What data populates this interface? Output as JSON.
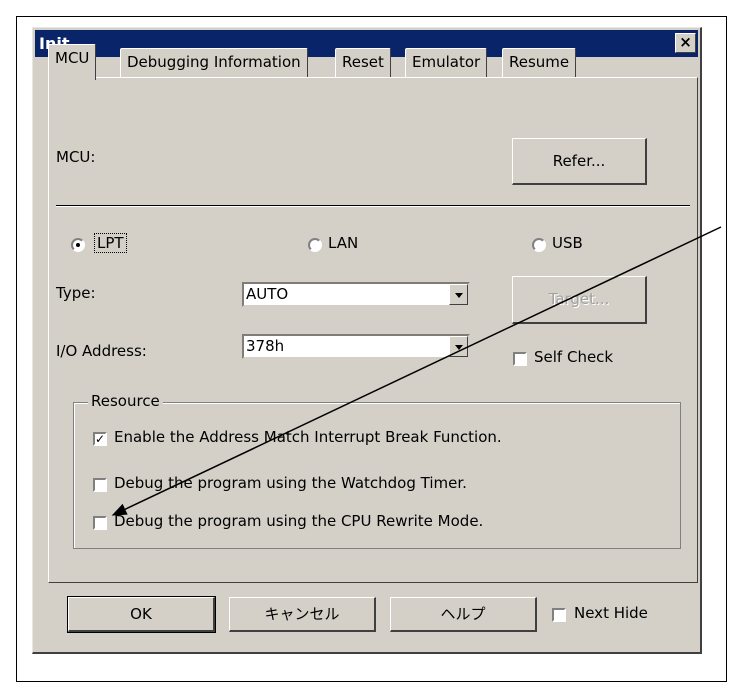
{
  "window": {
    "title": "Init",
    "close_label": "×"
  },
  "tabs": [
    {
      "label": "MCU",
      "active": true
    },
    {
      "label": "Debugging Information"
    },
    {
      "label": "Reset"
    },
    {
      "label": "Emulator"
    },
    {
      "label": "Resume"
    }
  ],
  "mcu": {
    "label": "MCU:",
    "refer_button": "Refer..."
  },
  "connection": {
    "lpt": "LPT",
    "lan": "LAN",
    "usb": "USB",
    "selected": "LPT"
  },
  "fields": {
    "type_label": "Type:",
    "type_value": "AUTO",
    "io_label": "I/O Address:",
    "io_value": "378h",
    "target_button": "Target...",
    "self_check": "Self Check"
  },
  "resource": {
    "title": "Resource",
    "options": [
      {
        "label": "Enable the Address Match Interrupt Break Function.",
        "checked": true
      },
      {
        "label": "Debug the program using the Watchdog Timer.",
        "checked": false
      },
      {
        "label": "Debug the program using the CPU Rewrite Mode.",
        "checked": false
      }
    ]
  },
  "footer": {
    "ok": "OK",
    "cancel": "キャンセル",
    "help": "ヘルプ",
    "next_hide": "Next Hide"
  },
  "colors": {
    "titlebar": "#0a246a",
    "face": "#d4d0c8"
  }
}
